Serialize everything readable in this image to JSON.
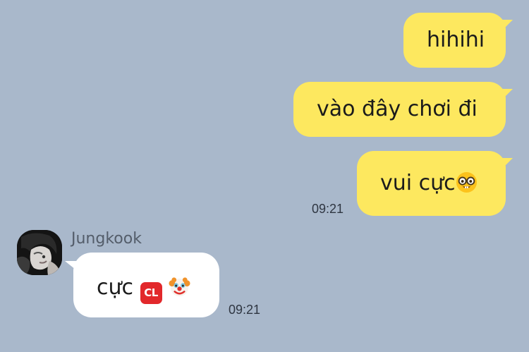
{
  "messages_out": [
    {
      "text": "hihihi"
    },
    {
      "text": "vào đây chơi đi"
    },
    {
      "text": "vui cực",
      "emoji": "nerd-face-emoji",
      "time": "09:21"
    }
  ],
  "message_in": {
    "sender": "Jungkook",
    "text": "cực",
    "badge": "CL",
    "emoji": "clown-face-emoji",
    "time": "09:21"
  },
  "colors": {
    "background": "#a9b8cb",
    "outgoing_bubble": "#fde85f",
    "incoming_bubble": "#ffffff",
    "badge": "#e2282b"
  }
}
